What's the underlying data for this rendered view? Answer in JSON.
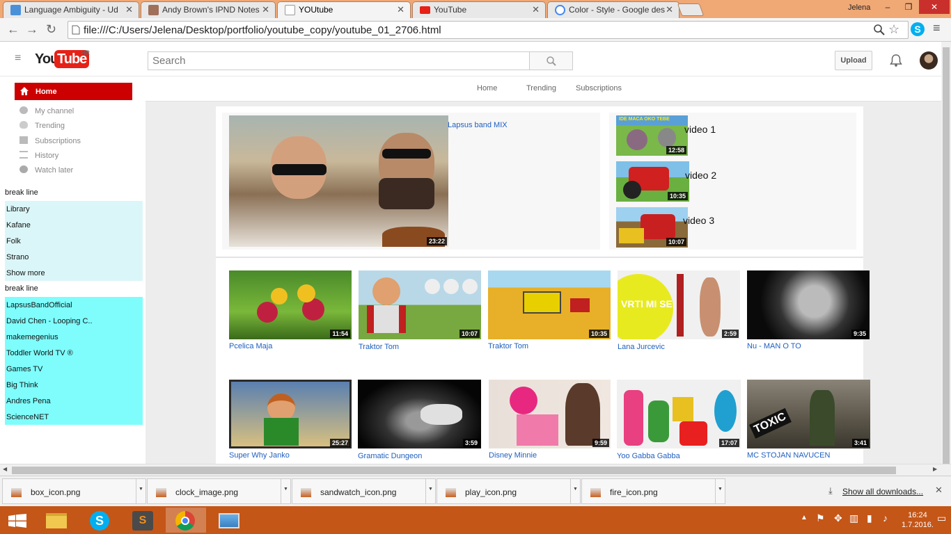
{
  "browser": {
    "tabs": [
      {
        "title": "Language Ambiguity - Ud",
        "icon": "udacity-icon",
        "color": "#4a90d9"
      },
      {
        "title": "Andy Brown's IPND Notes",
        "icon": "notes-icon",
        "color": "#a0705a"
      },
      {
        "title": "YOUtube",
        "icon": "page-icon",
        "color": "#ffffff",
        "active": true
      },
      {
        "title": "YouTube",
        "icon": "youtube-icon",
        "color": "#e62117"
      },
      {
        "title": "Color - Style - Google des",
        "icon": "google-icon",
        "color": "#4285f4"
      }
    ],
    "user": "Jelena",
    "url": "file:///C:/Users/Jelena/Desktop/portfolio/youtube_copy/youtube_01_2706.html"
  },
  "header": {
    "logo_you": "You",
    "logo_tube": "Tube",
    "logo_region": "HR",
    "search_placeholder": "Search",
    "upload_label": "Upload"
  },
  "sidebar": {
    "home_label": "Home",
    "items": [
      {
        "label": "My channel",
        "icon": "person-icon"
      },
      {
        "label": "Trending",
        "icon": "fire-icon"
      },
      {
        "label": "Subscriptions",
        "icon": "box-icon"
      },
      {
        "label": "History",
        "icon": "sandwatch-icon"
      },
      {
        "label": "Watch later",
        "icon": "clock-icon"
      }
    ],
    "break_line_1": "break line",
    "library": [
      "Library",
      "Kafane",
      "Folk",
      "Strano",
      "Show more"
    ],
    "break_line_2": "break line",
    "subscriptions": [
      "LapsusBandOfficial",
      "David Chen - Looping C..",
      "makemegenius",
      "Toddler World TV ®",
      "Games TV",
      "Big Think",
      "Andres Pena",
      "ScienceNET"
    ],
    "library_bg": "#dbf6f8",
    "subs_bg": "#7ffdfd"
  },
  "subnav": {
    "tabs": [
      "Home",
      "Trending",
      "Subscriptions"
    ]
  },
  "featured": {
    "title": "Lapsus band MIX",
    "duration": "23:22"
  },
  "side_videos": [
    {
      "title": "video 1",
      "duration": "12:58"
    },
    {
      "title": "video 2",
      "duration": "10:35"
    },
    {
      "title": "video 3",
      "duration": "10:07"
    }
  ],
  "grid": [
    {
      "title": "Pcelica Maja",
      "duration": "11:54"
    },
    {
      "title": "Traktor Tom",
      "duration": "10:07"
    },
    {
      "title": "Traktor Tom",
      "duration": "10:35"
    },
    {
      "title": "Lana Jurcevic",
      "duration": "2:59"
    },
    {
      "title": "Nu - MAN O TO",
      "duration": "9:35"
    },
    {
      "title": "Super Why Janko",
      "duration": "25:27"
    },
    {
      "title": "Gramatic Dungeon",
      "duration": "3:59"
    },
    {
      "title": "Disney Minnie",
      "duration": "9:59"
    },
    {
      "title": "Yoo Gabba Gabba",
      "duration": "17:07"
    },
    {
      "title": "MC STOJAN NAVUCEN",
      "duration": "3:41"
    }
  ],
  "downloads": {
    "files": [
      "box_icon.png",
      "clock_image.png",
      "sandwatch_icon.png",
      "play_icon.png",
      "fire_icon.png"
    ],
    "show_all": "Show all downloads..."
  },
  "taskbar": {
    "time": "16:24",
    "date": "1.7.2016."
  }
}
